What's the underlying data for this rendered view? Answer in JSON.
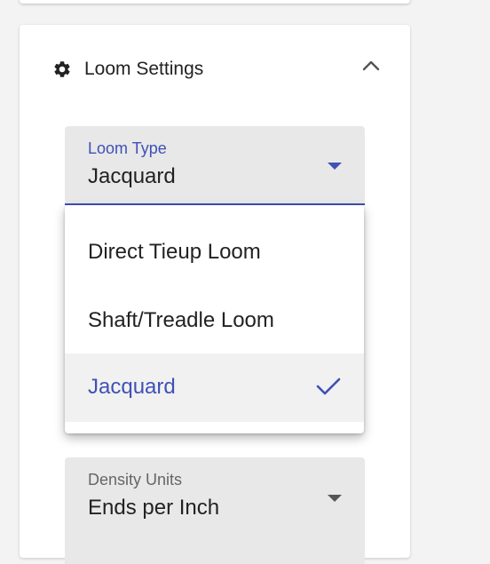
{
  "settings_panel": {
    "title": "Loom Settings",
    "icon": "gear-icon",
    "collapse_icon": "chevron-up-icon"
  },
  "loom_type": {
    "label": "Loom Type",
    "value": "Jacquard",
    "options": [
      {
        "label": "Direct Tieup Loom",
        "selected": false
      },
      {
        "label": "Shaft/Treadle Loom",
        "selected": false
      },
      {
        "label": "Jacquard",
        "selected": true
      }
    ]
  },
  "density_units": {
    "label": "Density Units",
    "value": "Ends per Inch"
  },
  "colors": {
    "accent": "#3f51b5",
    "field_background": "#e8e8e8",
    "selected_item_background": "#f1f1f1"
  }
}
